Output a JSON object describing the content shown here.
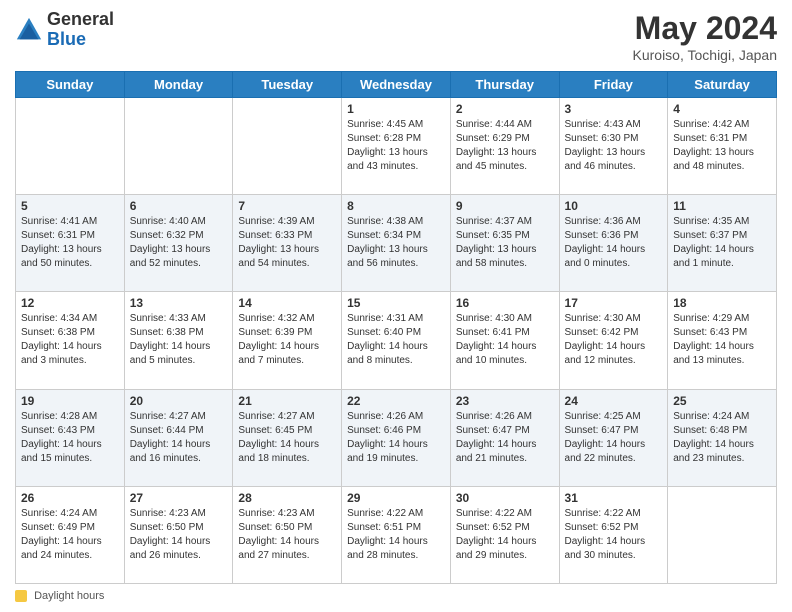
{
  "logo": {
    "general": "General",
    "blue": "Blue"
  },
  "title": "May 2024",
  "subtitle": "Kuroiso, Tochigi, Japan",
  "days_of_week": [
    "Sunday",
    "Monday",
    "Tuesday",
    "Wednesday",
    "Thursday",
    "Friday",
    "Saturday"
  ],
  "footer_label": "Daylight hours",
  "weeks": [
    [
      {
        "day": "",
        "info": ""
      },
      {
        "day": "",
        "info": ""
      },
      {
        "day": "",
        "info": ""
      },
      {
        "day": "1",
        "info": "Sunrise: 4:45 AM\nSunset: 6:28 PM\nDaylight: 13 hours\nand 43 minutes."
      },
      {
        "day": "2",
        "info": "Sunrise: 4:44 AM\nSunset: 6:29 PM\nDaylight: 13 hours\nand 45 minutes."
      },
      {
        "day": "3",
        "info": "Sunrise: 4:43 AM\nSunset: 6:30 PM\nDaylight: 13 hours\nand 46 minutes."
      },
      {
        "day": "4",
        "info": "Sunrise: 4:42 AM\nSunset: 6:31 PM\nDaylight: 13 hours\nand 48 minutes."
      }
    ],
    [
      {
        "day": "5",
        "info": "Sunrise: 4:41 AM\nSunset: 6:31 PM\nDaylight: 13 hours\nand 50 minutes."
      },
      {
        "day": "6",
        "info": "Sunrise: 4:40 AM\nSunset: 6:32 PM\nDaylight: 13 hours\nand 52 minutes."
      },
      {
        "day": "7",
        "info": "Sunrise: 4:39 AM\nSunset: 6:33 PM\nDaylight: 13 hours\nand 54 minutes."
      },
      {
        "day": "8",
        "info": "Sunrise: 4:38 AM\nSunset: 6:34 PM\nDaylight: 13 hours\nand 56 minutes."
      },
      {
        "day": "9",
        "info": "Sunrise: 4:37 AM\nSunset: 6:35 PM\nDaylight: 13 hours\nand 58 minutes."
      },
      {
        "day": "10",
        "info": "Sunrise: 4:36 AM\nSunset: 6:36 PM\nDaylight: 14 hours\nand 0 minutes."
      },
      {
        "day": "11",
        "info": "Sunrise: 4:35 AM\nSunset: 6:37 PM\nDaylight: 14 hours\nand 1 minute."
      }
    ],
    [
      {
        "day": "12",
        "info": "Sunrise: 4:34 AM\nSunset: 6:38 PM\nDaylight: 14 hours\nand 3 minutes."
      },
      {
        "day": "13",
        "info": "Sunrise: 4:33 AM\nSunset: 6:38 PM\nDaylight: 14 hours\nand 5 minutes."
      },
      {
        "day": "14",
        "info": "Sunrise: 4:32 AM\nSunset: 6:39 PM\nDaylight: 14 hours\nand 7 minutes."
      },
      {
        "day": "15",
        "info": "Sunrise: 4:31 AM\nSunset: 6:40 PM\nDaylight: 14 hours\nand 8 minutes."
      },
      {
        "day": "16",
        "info": "Sunrise: 4:30 AM\nSunset: 6:41 PM\nDaylight: 14 hours\nand 10 minutes."
      },
      {
        "day": "17",
        "info": "Sunrise: 4:30 AM\nSunset: 6:42 PM\nDaylight: 14 hours\nand 12 minutes."
      },
      {
        "day": "18",
        "info": "Sunrise: 4:29 AM\nSunset: 6:43 PM\nDaylight: 14 hours\nand 13 minutes."
      }
    ],
    [
      {
        "day": "19",
        "info": "Sunrise: 4:28 AM\nSunset: 6:43 PM\nDaylight: 14 hours\nand 15 minutes."
      },
      {
        "day": "20",
        "info": "Sunrise: 4:27 AM\nSunset: 6:44 PM\nDaylight: 14 hours\nand 16 minutes."
      },
      {
        "day": "21",
        "info": "Sunrise: 4:27 AM\nSunset: 6:45 PM\nDaylight: 14 hours\nand 18 minutes."
      },
      {
        "day": "22",
        "info": "Sunrise: 4:26 AM\nSunset: 6:46 PM\nDaylight: 14 hours\nand 19 minutes."
      },
      {
        "day": "23",
        "info": "Sunrise: 4:26 AM\nSunset: 6:47 PM\nDaylight: 14 hours\nand 21 minutes."
      },
      {
        "day": "24",
        "info": "Sunrise: 4:25 AM\nSunset: 6:47 PM\nDaylight: 14 hours\nand 22 minutes."
      },
      {
        "day": "25",
        "info": "Sunrise: 4:24 AM\nSunset: 6:48 PM\nDaylight: 14 hours\nand 23 minutes."
      }
    ],
    [
      {
        "day": "26",
        "info": "Sunrise: 4:24 AM\nSunset: 6:49 PM\nDaylight: 14 hours\nand 24 minutes."
      },
      {
        "day": "27",
        "info": "Sunrise: 4:23 AM\nSunset: 6:50 PM\nDaylight: 14 hours\nand 26 minutes."
      },
      {
        "day": "28",
        "info": "Sunrise: 4:23 AM\nSunset: 6:50 PM\nDaylight: 14 hours\nand 27 minutes."
      },
      {
        "day": "29",
        "info": "Sunrise: 4:22 AM\nSunset: 6:51 PM\nDaylight: 14 hours\nand 28 minutes."
      },
      {
        "day": "30",
        "info": "Sunrise: 4:22 AM\nSunset: 6:52 PM\nDaylight: 14 hours\nand 29 minutes."
      },
      {
        "day": "31",
        "info": "Sunrise: 4:22 AM\nSunset: 6:52 PM\nDaylight: 14 hours\nand 30 minutes."
      },
      {
        "day": "",
        "info": ""
      }
    ]
  ]
}
